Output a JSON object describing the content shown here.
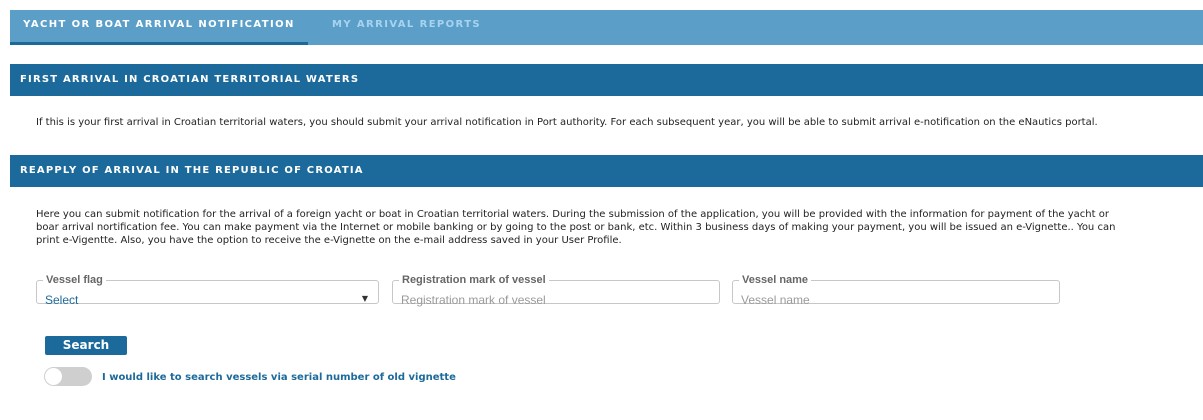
{
  "tabs": [
    {
      "label": "YACHT OR BOAT ARRIVAL NOTIFICATION",
      "active": true
    },
    {
      "label": "MY ARRIVAL REPORTS",
      "active": false
    }
  ],
  "first_arrival": {
    "title": "FIRST ARRIVAL IN CROATIAN TERRITORIAL WATERS",
    "text": "If this is your first arrival in Croatian territorial waters, you should submit your arrival notification in Port authority. For each subsequent year, you will be able to submit arrival e-notification on the eNautics portal."
  },
  "reapply": {
    "title": "REAPPLY OF ARRIVAL IN THE REPUBLIC OF CROATIA",
    "text": "Here you can submit notification for the arrival of a foreign yacht or boat in Croatian territorial waters. During the submission of the application, you will be provided with the information for payment of the yacht or boar arrival nortification fee. You can make payment via the Internet or mobile banking or by going to the post or bank, etc. Within 3 business days of making your payment, you will be issued an e-Vignette.. You can print e-Vigentte. Also, you have the option to receive the e-Vignette on the e-mail address saved in your User Profile."
  },
  "form": {
    "vessel_flag": {
      "label": "Vessel flag",
      "value": "Select"
    },
    "registration_mark": {
      "label": "Registration mark of vessel",
      "placeholder": "Registration mark of vessel"
    },
    "vessel_name": {
      "label": "Vessel name",
      "placeholder": "Vessel name"
    },
    "search_label": "Search",
    "toggle_label": "I would like to search vessels via serial number of old vignette",
    "toggle_on": false
  },
  "colors": {
    "tab_bar": "#5b9fc9",
    "header": "#1c6a9b",
    "accent": "#1c6a9b",
    "toggle_off": "#cfcfcf"
  }
}
